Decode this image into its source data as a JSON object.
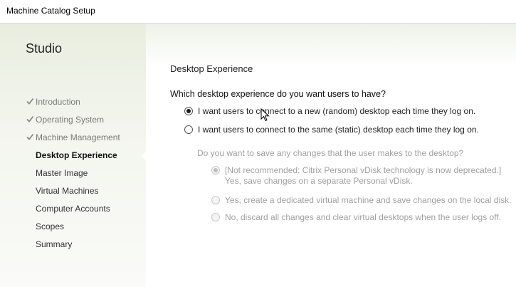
{
  "window": {
    "title": "Machine Catalog Setup"
  },
  "sidebar": {
    "heading": "Studio",
    "steps": [
      {
        "label": "Introduction",
        "state": "done"
      },
      {
        "label": "Operating System",
        "state": "done"
      },
      {
        "label": "Machine Management",
        "state": "done"
      },
      {
        "label": "Desktop Experience",
        "state": "active"
      },
      {
        "label": "Master Image",
        "state": "pending"
      },
      {
        "label": "Virtual Machines",
        "state": "pending"
      },
      {
        "label": "Computer Accounts",
        "state": "pending"
      },
      {
        "label": "Scopes",
        "state": "pending"
      },
      {
        "label": "Summary",
        "state": "pending"
      }
    ]
  },
  "main": {
    "section_title": "Desktop Experience",
    "question": "Which desktop experience do you want users to have?",
    "experience_options": [
      {
        "label": "I want users to connect to a new (random) desktop each time they log on.",
        "selected": true
      },
      {
        "label": "I want users to connect to the same (static) desktop each time they log on.",
        "selected": false
      }
    ],
    "save_question": "Do you want to save any changes that the user makes to the desktop?",
    "save_options": [
      {
        "line1": "[Not recommended: Citrix Personal vDisk technology is now deprecated.]",
        "line2": "Yes, save changes on a separate Personal vDisk.",
        "selected": true,
        "enabled": false
      },
      {
        "line1": "Yes, create a dedicated virtual machine and save changes on the local disk.",
        "selected": false,
        "enabled": false
      },
      {
        "line1": "No, discard all changes and clear virtual desktops when the user logs off.",
        "selected": false,
        "enabled": false
      }
    ]
  }
}
